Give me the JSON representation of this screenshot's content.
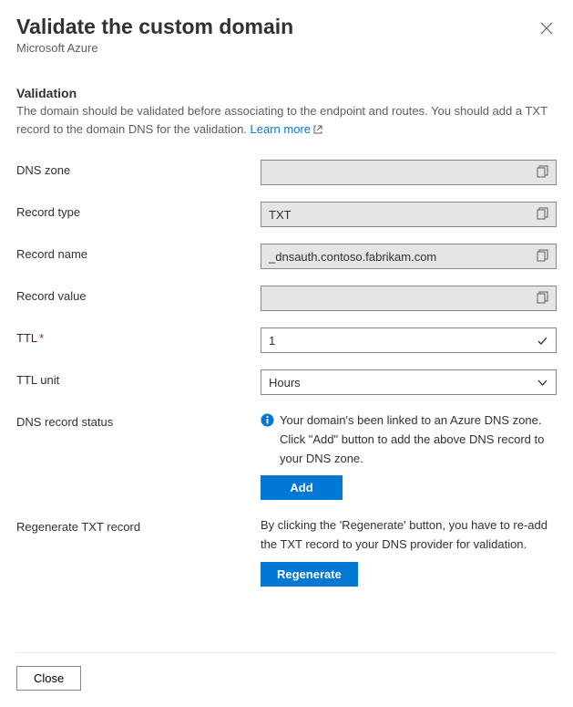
{
  "header": {
    "title": "Validate the custom domain",
    "subtitle": "Microsoft Azure"
  },
  "validation": {
    "section_title": "Validation",
    "description_pre": "The domain should be validated before associating to the endpoint and routes. You should add a TXT record to the domain DNS for the validation. ",
    "learn_more": "Learn more"
  },
  "fields": {
    "dns_zone": {
      "label": "DNS zone",
      "value": ""
    },
    "record_type": {
      "label": "Record type",
      "value": "TXT"
    },
    "record_name": {
      "label": "Record name",
      "value": "_dnsauth.contoso.fabrikam.com"
    },
    "record_value": {
      "label": "Record value",
      "value": ""
    },
    "ttl": {
      "label": "TTL",
      "value": "1"
    },
    "ttl_unit": {
      "label": "TTL unit",
      "value": "Hours"
    },
    "dns_status": {
      "label": "DNS record status",
      "message": "Your domain's been linked to an Azure DNS zone. Click \"Add\" button to add the above DNS record to your DNS zone.",
      "button": "Add"
    },
    "regenerate": {
      "label": "Regenerate TXT record",
      "message": "By clicking the 'Regenerate' button, you have to re-add the TXT record to your DNS provider for validation.",
      "button": "Regenerate"
    }
  },
  "footer": {
    "close": "Close"
  }
}
